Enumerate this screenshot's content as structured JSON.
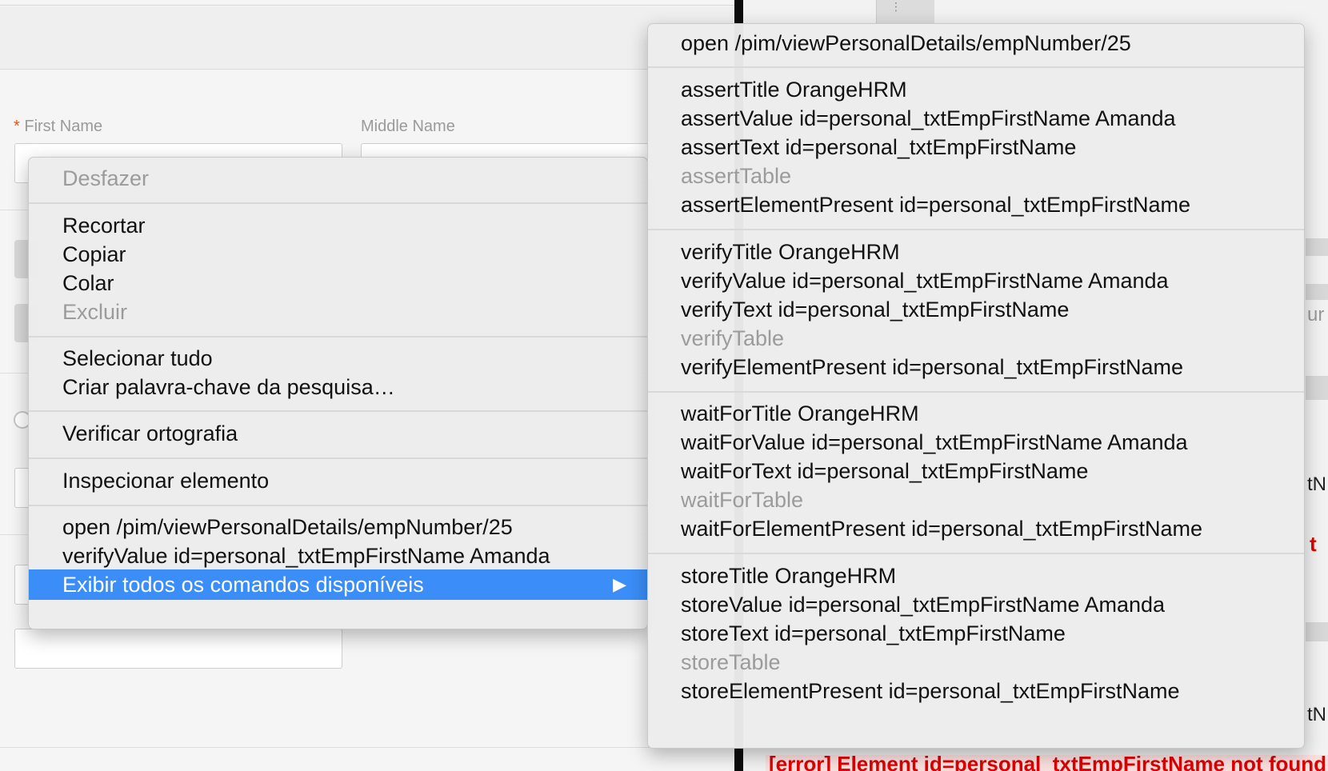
{
  "form": {
    "first_name_label": "First Name",
    "required_marker": "*",
    "middle_name_label": "Middle Name"
  },
  "log": {
    "error_text": "[error] Element id=personal_txtEmpFirstName not found"
  },
  "right_edge": {
    "fragment_1": "ur",
    "fragment_2": "tN",
    "fragment_3": "t",
    "fragment_4": "tN"
  },
  "context_menu": {
    "undo": "Desfazer",
    "cut": "Recortar",
    "copy": "Copiar",
    "paste": "Colar",
    "delete": "Excluir",
    "select_all": "Selecionar tudo",
    "create_keyword": "Criar palavra-chave da pesquisa…",
    "spell_check": "Verificar ortografia",
    "inspect": "Inspecionar elemento",
    "cmd_open": "open /pim/viewPersonalDetails/empNumber/25",
    "cmd_verify_value": "verifyValue id=personal_txtEmpFirstName Amanda",
    "show_all": "Exibir todos os comandos disponíveis",
    "submenu_arrow": "▶"
  },
  "submenu": {
    "open": "open /pim/viewPersonalDetails/empNumber/25",
    "assert": [
      "assertTitle OrangeHRM",
      "assertValue id=personal_txtEmpFirstName Amanda",
      "assertText id=personal_txtEmpFirstName",
      "assertTable",
      "assertElementPresent id=personal_txtEmpFirstName"
    ],
    "verify": [
      "verifyTitle OrangeHRM",
      "verifyValue id=personal_txtEmpFirstName Amanda",
      "verifyText id=personal_txtEmpFirstName",
      "verifyTable",
      "verifyElementPresent id=personal_txtEmpFirstName"
    ],
    "waitfor": [
      "waitForTitle OrangeHRM",
      "waitForValue id=personal_txtEmpFirstName Amanda",
      "waitForText id=personal_txtEmpFirstName",
      "waitForTable",
      "waitForElementPresent id=personal_txtEmpFirstName"
    ],
    "store": [
      "storeTitle OrangeHRM",
      "storeValue id=personal_txtEmpFirstName Amanda",
      "storeText id=personal_txtEmpFirstName",
      "storeTable",
      "storeElementPresent id=personal_txtEmpFirstName"
    ]
  },
  "colors": {
    "highlight": "#3b8df7",
    "disabled_text": "#9b9b9b",
    "error_red": "#e00000",
    "required_star": "#e0521b"
  }
}
